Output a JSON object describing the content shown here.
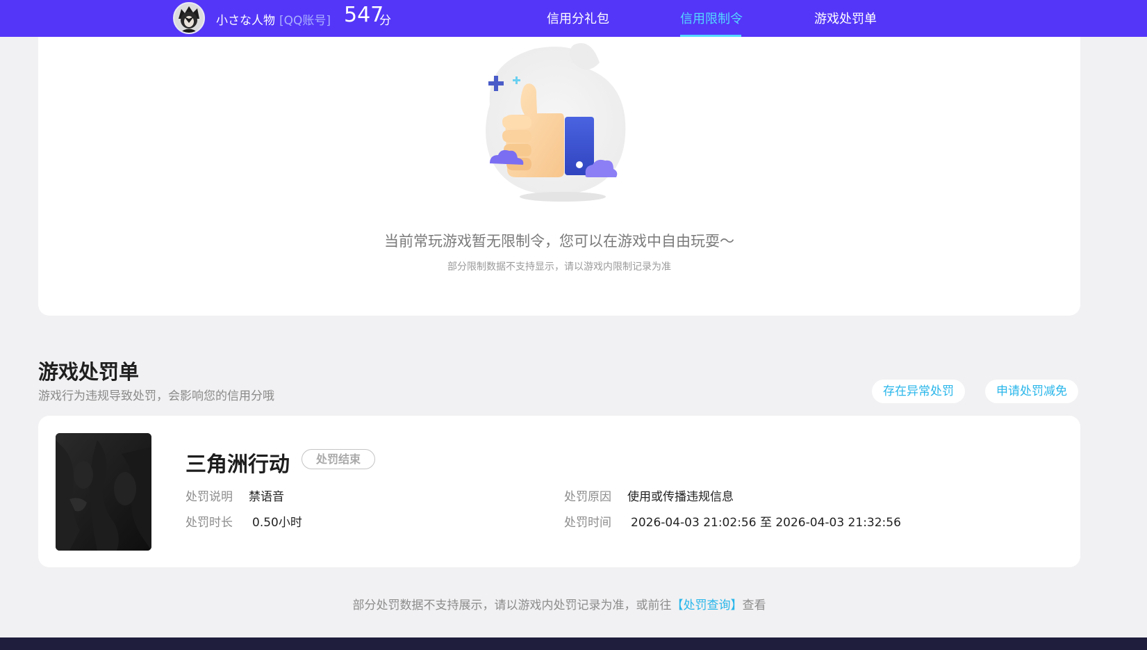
{
  "header": {
    "nickname": "小さな人物",
    "account_type": "[QQ账号]",
    "score": "547",
    "score_unit": "分",
    "tabs": [
      {
        "label": "信用分礼包",
        "active": false
      },
      {
        "label": "信用限制令",
        "active": true
      },
      {
        "label": "游戏处罚单",
        "active": false
      }
    ],
    "accent_color": "#5436f8",
    "active_tab_color": "#53d8ff"
  },
  "restriction": {
    "empty_title": "当前常玩游戏暂无限制令，您可以在游戏中自由玩耍～",
    "empty_subtitle": "部分限制数据不支持显示，请以游戏内限制记录为准",
    "illustration_icon": "thumbs-up-icon"
  },
  "penalty": {
    "section_title": "游戏处罚单",
    "section_desc": "游戏行为违规导致处罚，会影响您的信用分哦",
    "actions": [
      "存在异常处罚",
      "申请处罚减免"
    ],
    "items": [
      {
        "game_name": "三角洲行动",
        "status": "处罚结束",
        "desc_label": "处罚说明",
        "desc_value": "禁语音",
        "reason_label": "处罚原因",
        "reason_value": "使用或传播违规信息",
        "duration_label": "处罚时长",
        "duration_value": "0.50小时",
        "time_label": "处罚时间",
        "time_value": "2026-04-03 21:02:56 至 2026-04-03 21:32:56"
      }
    ],
    "footer_prefix": "部分处罚数据不支持展示，请以游戏内处罚记录为准，或前往",
    "footer_link": "【处罚查询】",
    "footer_suffix": "查看",
    "link_color": "#29b6ea"
  }
}
